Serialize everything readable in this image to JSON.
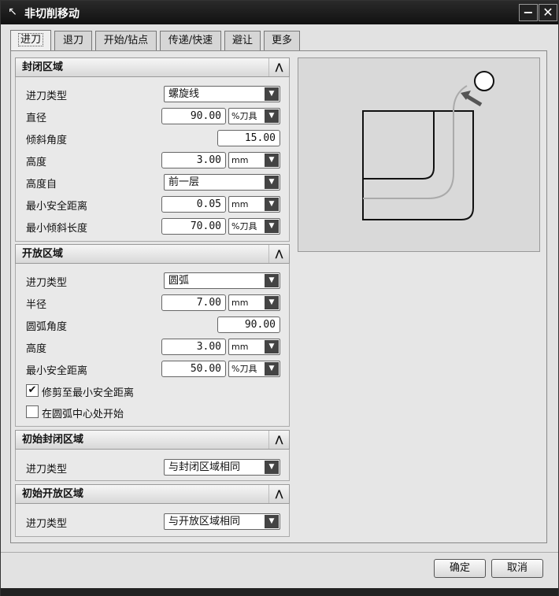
{
  "window": {
    "title": "非切削移动"
  },
  "tabs": [
    "进刀",
    "退刀",
    "开始/钻点",
    "传递/快速",
    "避让",
    "更多"
  ],
  "closed_region": {
    "header": "封闭区域",
    "entry_type_label": "进刀类型",
    "entry_type_value": "螺旋线",
    "diameter_label": "直径",
    "diameter_value": "90.00",
    "diameter_unit": "%刀具",
    "ramp_angle_label": "倾斜角度",
    "ramp_angle_value": "15.00",
    "height_label": "高度",
    "height_value": "3.00",
    "height_unit": "mm",
    "height_from_label": "高度自",
    "height_from_value": "前一层",
    "min_clearance_label": "最小安全距离",
    "min_clearance_value": "0.05",
    "min_clearance_unit": "mm",
    "min_ramp_len_label": "最小倾斜长度",
    "min_ramp_len_value": "70.00",
    "min_ramp_len_unit": "%刀具"
  },
  "open_region": {
    "header": "开放区域",
    "entry_type_label": "进刀类型",
    "entry_type_value": "圆弧",
    "radius_label": "半径",
    "radius_value": "7.00",
    "radius_unit": "mm",
    "arc_angle_label": "圆弧角度",
    "arc_angle_value": "90.00",
    "height_label": "高度",
    "height_value": "3.00",
    "height_unit": "mm",
    "min_clearance_label": "最小安全距离",
    "min_clearance_value": "50.00",
    "min_clearance_unit": "%刀具",
    "trim_label": "修剪至最小安全距离",
    "trim_checked": true,
    "arc_center_label": "在圆弧中心处开始",
    "arc_center_checked": false
  },
  "initial_closed": {
    "header": "初始封闭区域",
    "entry_type_label": "进刀类型",
    "entry_type_value": "与封闭区域相同"
  },
  "initial_open": {
    "header": "初始开放区域",
    "entry_type_label": "进刀类型",
    "entry_type_value": "与开放区域相同"
  },
  "footer": {
    "ok": "确定",
    "cancel": "取消"
  },
  "icons": {
    "collapse": "chevron-up-icon",
    "dropdown": "chevron-down-icon",
    "check": "checkmark-icon"
  }
}
